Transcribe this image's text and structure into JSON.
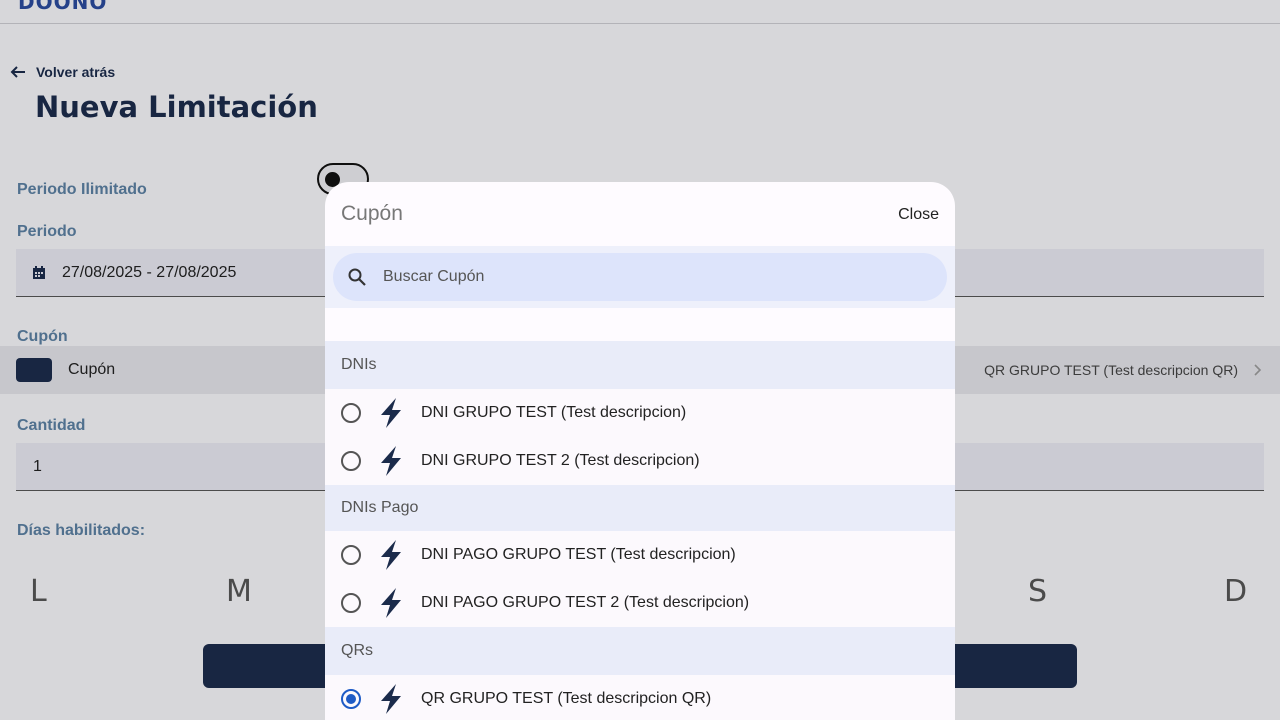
{
  "header": {
    "logo_text": "DOONO"
  },
  "page": {
    "back_label": "Volver atrás",
    "title": "Nueva Limitación",
    "periodo_ilimitado_label": "Periodo Ilimitado",
    "periodo_label": "Periodo",
    "periodo_value": "27/08/2025 - 27/08/2025",
    "cupon_label": "Cupón",
    "cupon_field_label": "Cupón",
    "cupon_selected_value": "QR GRUPO TEST (Test descripcion QR)",
    "cantidad_label": "Cantidad",
    "cantidad_value": "1",
    "dias_label": "Días habilitados:",
    "days": [
      "L",
      "M",
      "S",
      "D"
    ]
  },
  "modal": {
    "title": "Cupón",
    "close_label": "Close",
    "search_placeholder": "Buscar Cupón",
    "groups": [
      {
        "name": "DNIs",
        "options": [
          {
            "label": "DNI GRUPO TEST (Test descripcion)",
            "selected": false
          },
          {
            "label": "DNI GRUPO TEST 2 (Test descripcion)",
            "selected": false
          }
        ]
      },
      {
        "name": "DNIs Pago",
        "options": [
          {
            "label": "DNI PAGO GRUPO TEST (Test descripcion)",
            "selected": false
          },
          {
            "label": "DNI PAGO GRUPO TEST 2 (Test descripcion)",
            "selected": false
          }
        ]
      },
      {
        "name": "QRs",
        "options": [
          {
            "label": "QR GRUPO TEST (Test descripcion QR)",
            "selected": true
          }
        ]
      }
    ]
  },
  "colors": {
    "brand": "#1b2b4b",
    "accent": "#1e5bc6",
    "label": "#5a7ea0"
  }
}
